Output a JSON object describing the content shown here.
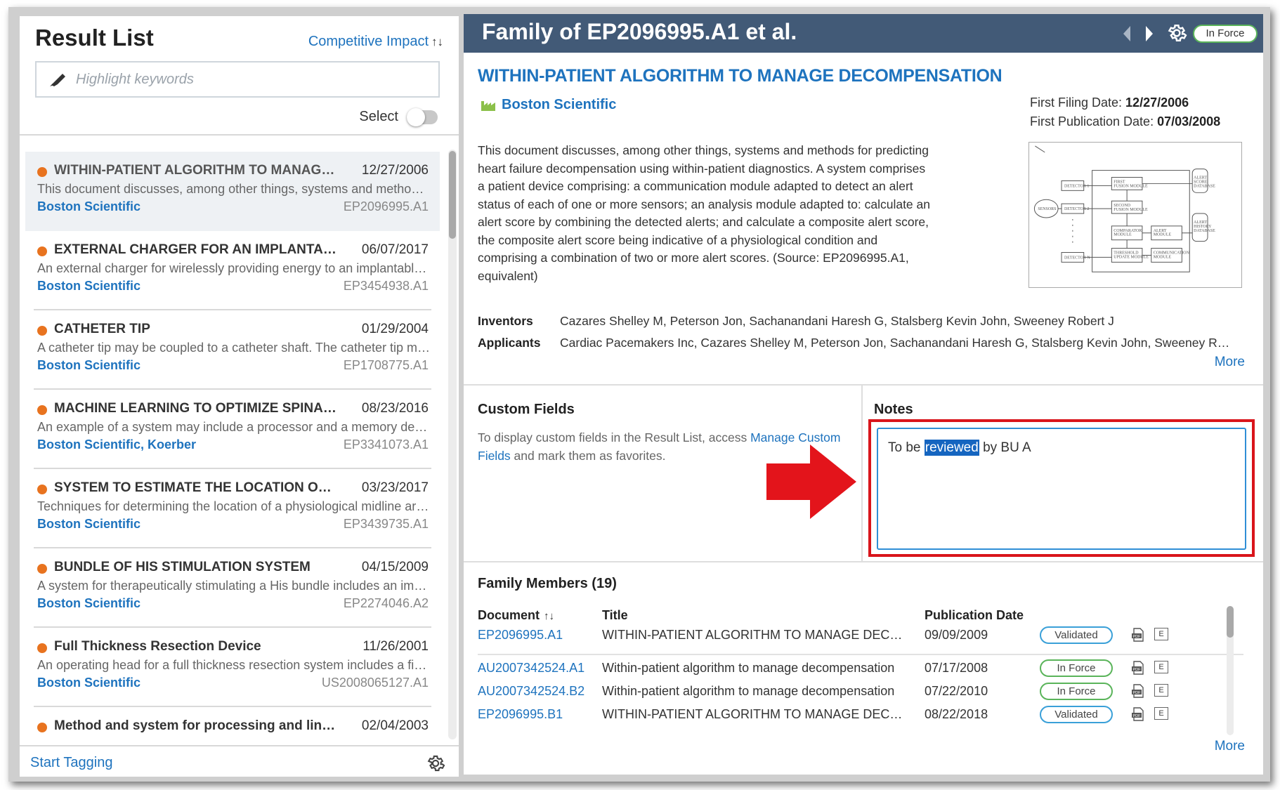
{
  "left": {
    "title": "Result List",
    "sort_label": "Competitive Impact",
    "sort_arrows": "↑↓",
    "highlight_placeholder": "Highlight keywords",
    "select_label": "Select",
    "start_tagging": "Start Tagging"
  },
  "results": [
    {
      "title": "WITHIN-PATIENT ALGORITHM TO MANAGE DECOMPENSATION",
      "date": "12/27/2006",
      "desc": "This document discusses, among other things, systems and methods for predicting heart failure",
      "company": "Boston Scientific",
      "pubno": "EP2096995.A1"
    },
    {
      "title": "EXTERNAL CHARGER FOR AN IMPLANTABLE MEDICAL DEVICE",
      "date": "06/07/2017",
      "desc": "An external charger for wirelessly providing energy to an implantable medical device",
      "company": "Boston Scientific",
      "pubno": "EP3454938.A1"
    },
    {
      "title": "CATHETER TIP",
      "date": "01/29/2004",
      "desc": "A catheter tip may be coupled to a catheter shaft. The catheter tip may include",
      "company": "Boston Scientific",
      "pubno": "EP1708775.A1"
    },
    {
      "title": "MACHINE LEARNING TO OPTIMIZE SPINAL CORD STIMULATION",
      "date": "08/23/2016",
      "desc": "An example of a system may include a processor and a memory device",
      "company": "Boston Scientific, Koerber",
      "pubno": "EP3341073.A1"
    },
    {
      "title": "SYSTEM TO ESTIMATE THE LOCATION OF A SPINAL CORD",
      "date": "03/23/2017",
      "desc": "Techniques for determining the location of a physiological midline are described",
      "company": "Boston Scientific",
      "pubno": "EP3439735.A1"
    },
    {
      "title": "BUNDLE OF HIS STIMULATION SYSTEM",
      "date": "04/15/2009",
      "desc": "A system for therapeutically stimulating a His bundle includes an implantable",
      "company": "Boston Scientific",
      "pubno": "EP2274046.A2"
    },
    {
      "title": "Full Thickness Resection Device",
      "date": "11/26/2001",
      "desc": "An operating head for a full thickness resection system includes a first portion",
      "company": "Boston Scientific",
      "pubno": "US2008065127.A1"
    },
    {
      "title": "Method and system for processing and linking data records",
      "date": "02/04/2003",
      "desc": "",
      "company": "",
      "pubno": ""
    }
  ],
  "detail": {
    "header_title": "Family of EP2096995.A1 et al.",
    "status": "In Force",
    "doc_title": "WITHIN-PATIENT ALGORITHM TO MANAGE DECOMPENSATION",
    "assignee": "Boston Scientific",
    "first_filing_label": "First Filing Date:",
    "first_filing_value": "12/27/2006",
    "first_pub_label": "First Publication Date:",
    "first_pub_value": "07/03/2008",
    "abstract": "This document discusses, among other things, systems and methods for predicting heart failure decompensation using within-patient diagnostics. A system comprises a patient device comprising: a communication module adapted to detect an alert status of each of one or more sensors; an analysis module adapted to: calculate an alert score by combining the detected alerts; and calculate a composite alert score, the composite alert score being indicative of a physiological condition and comprising a combination of two or more alert scores. (Source: EP2096995.A1, equivalent)",
    "inventors_label": "Inventors",
    "inventors": "Cazares Shelley M, Peterson Jon, Sachanandani Haresh G, Stalsberg Kevin John, Sweeney Robert J",
    "applicants_label": "Applicants",
    "applicants": "Cardiac Pacemakers Inc, Cazares Shelley M, Peterson Jon, Sachanandani Haresh G, Stalsberg Kevin John, Sweeney Robert J",
    "more": "More"
  },
  "custom_fields": {
    "title": "Custom Fields",
    "text_before": "To display custom fields in the Result List, access ",
    "link": "Manage Custom Fields",
    "text_after": " and mark them as favorites."
  },
  "notes": {
    "title": "Notes",
    "before": "To be ",
    "selected": "reviewed",
    "after": " by BU A"
  },
  "family": {
    "title": "Family Members (19)",
    "col_doc": "Document",
    "col_title": "Title",
    "col_date": "Publication Date",
    "more": "More",
    "rows": [
      {
        "doc": "EP2096995.A1",
        "title": "WITHIN-PATIENT ALGORITHM TO MANAGE DECOMPENSATION",
        "date": "09/09/2009",
        "status": "Validated"
      },
      {
        "doc": "AU2007342524.A1",
        "title": "Within-patient algorithm to manage decompensation",
        "date": "07/17/2008",
        "status": "In Force"
      },
      {
        "doc": "AU2007342524.B2",
        "title": "Within-patient algorithm to manage decompensation",
        "date": "07/22/2010",
        "status": "In Force"
      },
      {
        "doc": "EP2096995.B1",
        "title": "WITHIN-PATIENT ALGORITHM TO MANAGE DECOMPENSATION",
        "date": "08/22/2018",
        "status": "Validated"
      }
    ]
  },
  "colors": {
    "header": "#425a77",
    "link": "#1e73be",
    "dot": "#e8731f",
    "highlight_box": "#d9151b",
    "arrow": "#e3141b"
  }
}
